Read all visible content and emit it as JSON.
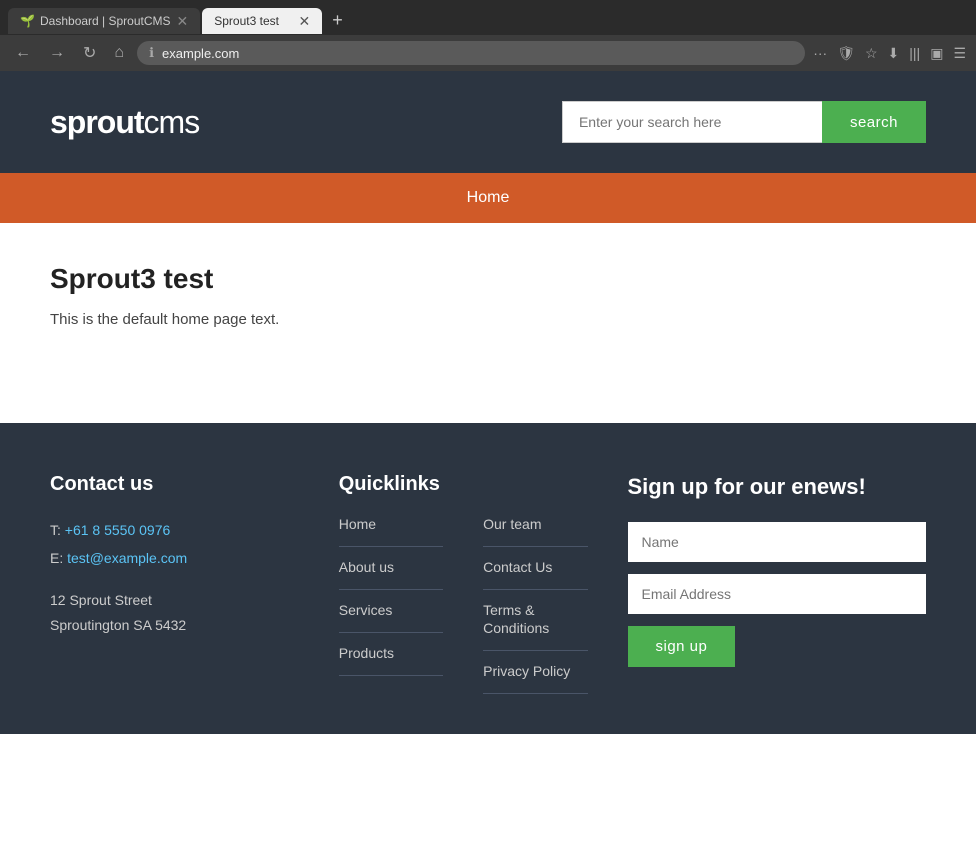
{
  "browser": {
    "tabs": [
      {
        "id": "tab1",
        "title": "Dashboard | SproutCMS",
        "active": false,
        "favicon": "🌱"
      },
      {
        "id": "tab2",
        "title": "Sprout3 test",
        "active": true,
        "favicon": ""
      }
    ],
    "address": "example.com"
  },
  "header": {
    "logo_bold": "sprout",
    "logo_light": "cms",
    "search_placeholder": "Enter your search here",
    "search_button_label": "search"
  },
  "nav": {
    "items": [
      {
        "label": "Home",
        "href": "#"
      }
    ]
  },
  "main": {
    "title": "Sprout3 test",
    "body": "This is the default home page text."
  },
  "footer": {
    "contact": {
      "heading": "Contact us",
      "phone_label": "T:",
      "phone": "+61 8 5550 0976",
      "email_label": "E:",
      "email": "test@example.com",
      "address_line1": "12 Sprout Street",
      "address_line2": "Sproutington SA 5432"
    },
    "quicklinks": {
      "heading": "Quicklinks",
      "col1": [
        {
          "label": "Home",
          "href": "#"
        },
        {
          "label": "About us",
          "href": "#"
        },
        {
          "label": "Services",
          "href": "#"
        },
        {
          "label": "Products",
          "href": "#"
        }
      ],
      "col2": [
        {
          "label": "Our team",
          "href": "#"
        },
        {
          "label": "Contact Us",
          "href": "#"
        },
        {
          "label": "Terms & Conditions",
          "href": "#"
        },
        {
          "label": "Privacy Policy",
          "href": "#"
        }
      ]
    },
    "signup": {
      "heading": "Sign up for our enews!",
      "name_placeholder": "Name",
      "email_placeholder": "Email Address",
      "button_label": "sign up"
    }
  }
}
